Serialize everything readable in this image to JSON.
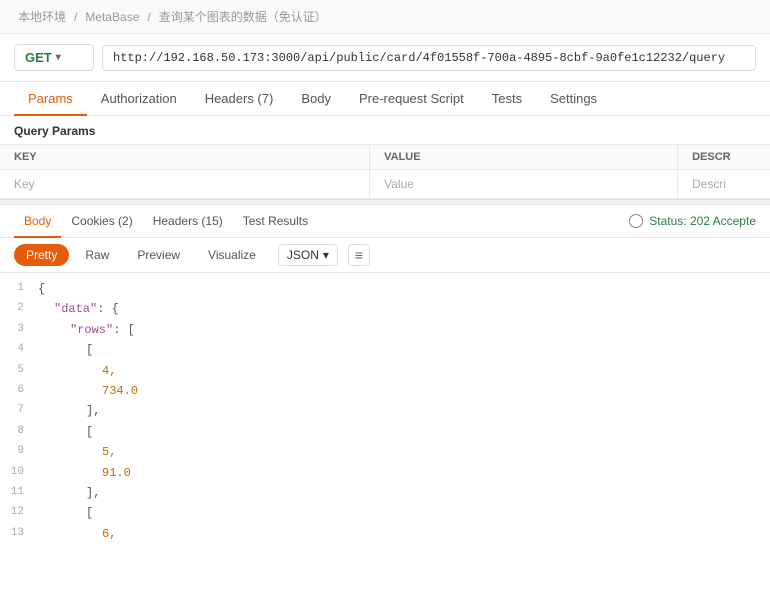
{
  "breadcrumb": {
    "items": [
      "本地环境",
      "MetaBase",
      "查询某个图表的数据（免认证）"
    ],
    "separators": [
      "/",
      "/"
    ]
  },
  "urlbar": {
    "method": "GET",
    "url": "http://192.168.50.173:3000/api/public/card/4f01558f-700a-4895-8cbf-9a0fe1c12232/query",
    "chevron": "▾"
  },
  "tabs": [
    {
      "label": "Params",
      "active": true
    },
    {
      "label": "Authorization",
      "active": false
    },
    {
      "label": "Headers (7)",
      "active": false
    },
    {
      "label": "Body",
      "active": false
    },
    {
      "label": "Pre-request Script",
      "active": false
    },
    {
      "label": "Tests",
      "active": false
    },
    {
      "label": "Settings",
      "active": false
    }
  ],
  "queryParams": {
    "sectionLabel": "Query Params",
    "columns": [
      "KEY",
      "VALUE",
      "DESCR"
    ],
    "rows": [
      {
        "key": "Key",
        "value": "Value",
        "desc": "Descri"
      }
    ]
  },
  "responseTabs": [
    {
      "label": "Body",
      "active": true
    },
    {
      "label": "Cookies (2)",
      "active": false
    },
    {
      "label": "Headers (15)",
      "active": false
    },
    {
      "label": "Test Results",
      "active": false
    }
  ],
  "responseStatus": "Status: 202 Accepte",
  "formatBar": {
    "buttons": [
      "Pretty",
      "Raw",
      "Preview",
      "Visualize"
    ],
    "activeButton": "Pretty",
    "jsonLabel": "JSON",
    "chevron": "▾"
  },
  "jsonLines": [
    {
      "num": 1,
      "content": "{"
    },
    {
      "num": 2,
      "content": "\"data\": {",
      "keyPart": "\"data\"",
      "rest": ": {"
    },
    {
      "num": 3,
      "content": "\"rows\": [",
      "keyPart": "\"rows\"",
      "rest": ": [",
      "indent": 8
    },
    {
      "num": 4,
      "content": "[",
      "indent": 12
    },
    {
      "num": 5,
      "content": "4,",
      "indent": 16,
      "type": "num"
    },
    {
      "num": 6,
      "content": "734.0",
      "indent": 16,
      "type": "num"
    },
    {
      "num": 7,
      "content": "],",
      "indent": 12
    },
    {
      "num": 8,
      "content": "[",
      "indent": 12
    },
    {
      "num": 9,
      "content": "5,",
      "indent": 16,
      "type": "num"
    },
    {
      "num": 10,
      "content": "91.0",
      "indent": 16,
      "type": "num"
    },
    {
      "num": 11,
      "content": "],",
      "indent": 12
    },
    {
      "num": 12,
      "content": "[",
      "indent": 12
    },
    {
      "num": 13,
      "content": "6,",
      "indent": 16,
      "type": "num"
    }
  ]
}
